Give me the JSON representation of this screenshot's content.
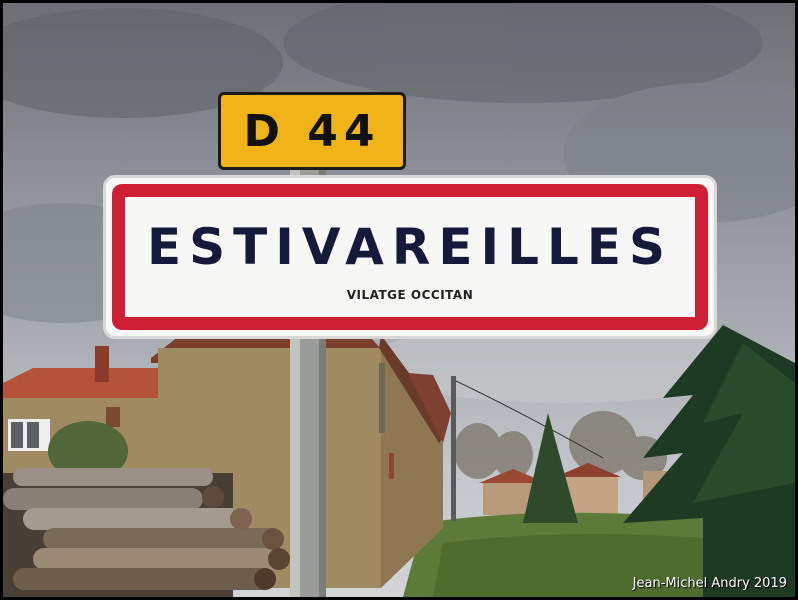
{
  "sign": {
    "road_number": "D 44",
    "town_name": "ESTIVAREILLES",
    "subtitle": "VILATGE OCCITAN"
  },
  "credit": "Jean-Michel Andry 2019",
  "colors": {
    "road_plate": "#f0b418",
    "sign_border": "#cf1f35",
    "sign_text": "#151a3a",
    "sky": "#9ea2a8",
    "stone": "#a08a62",
    "grass": "#5c7a38"
  }
}
